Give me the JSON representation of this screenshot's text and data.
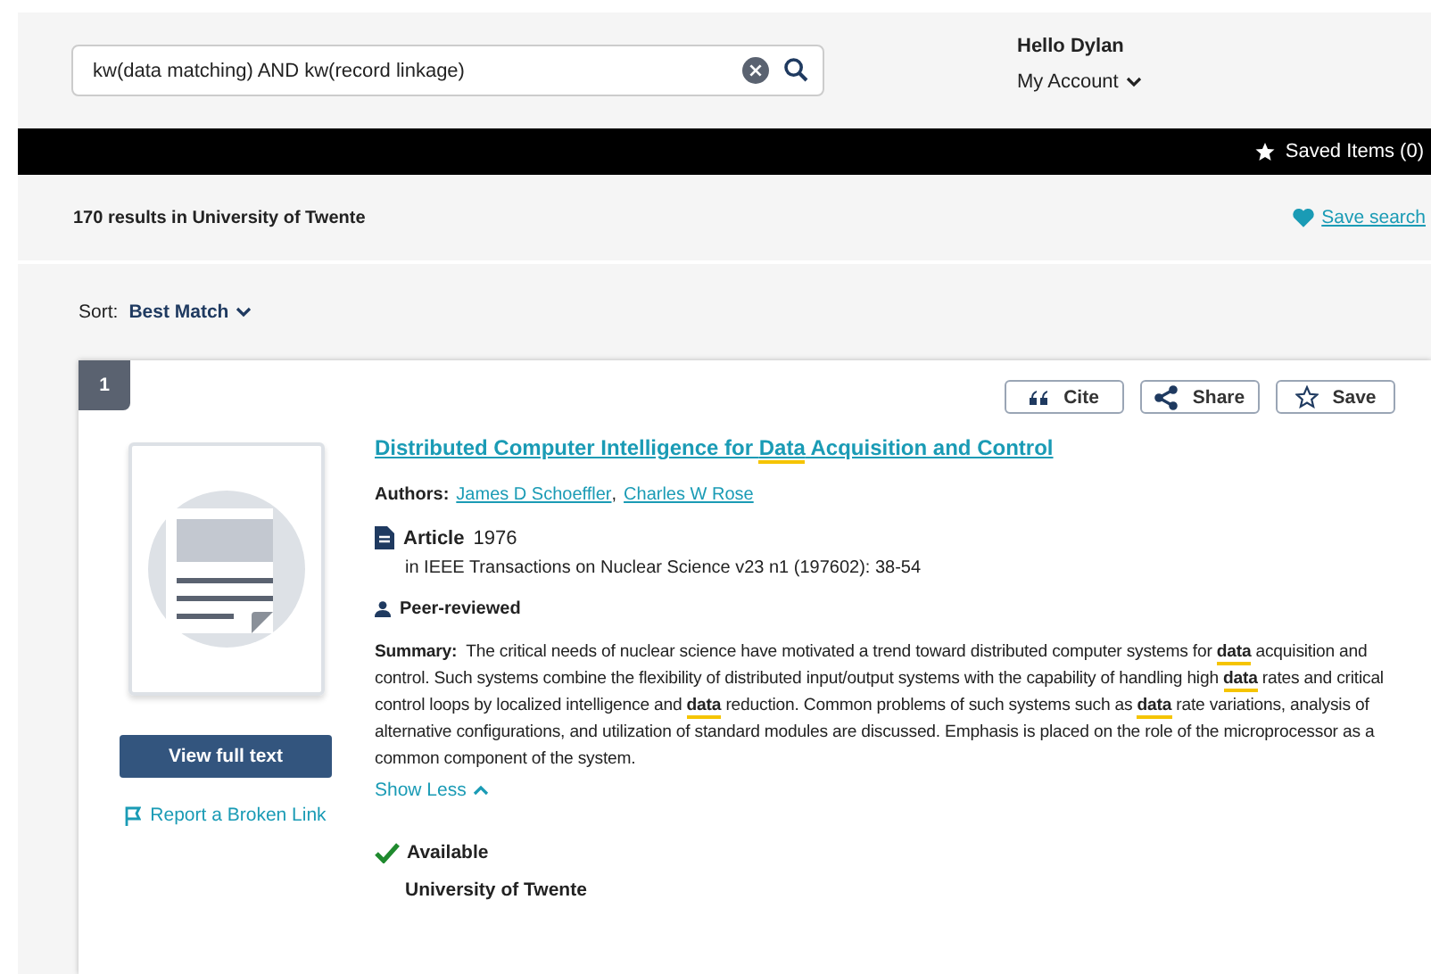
{
  "search": {
    "value": "kw(data matching) AND kw(record linkage)"
  },
  "account": {
    "greeting": "Hello Dylan",
    "menu": "My Account"
  },
  "saved_items": "Saved Items (0)",
  "results": {
    "count": "170 results in University of Twente",
    "save_search": "Save search"
  },
  "sort": {
    "label": "Sort:",
    "value": "Best Match"
  },
  "result": {
    "number": "1",
    "actions": [
      {
        "kind": "cite",
        "label": "Cite"
      },
      {
        "kind": "share",
        "label": "Share"
      },
      {
        "kind": "save",
        "label": "Save"
      }
    ],
    "title": "Distributed Computer Intelligence for *Data* Acquisition and Control",
    "authors_label": "Authors:",
    "authors": [
      {
        "name": "James D Schoeffler",
        "separator": ","
      },
      {
        "name": "Charles W Rose"
      }
    ],
    "type": "Article",
    "year": "1976",
    "source": "in IEEE Transactions on Nuclear Science v23 n1 (197602): 38-54",
    "peer_reviewed": "Peer-reviewed",
    "summary_label": "Summary:",
    "summary": "The critical needs of nuclear science have motivated a trend toward distributed computer systems for **data** acquisition and control. Such systems combine the flexibility of distributed input/output systems with the capability of handling high **data** rates and critical control loops by localized intelligence and **data** reduction. Common problems of such systems such as **data** rate variations, analysis of alternative configurations, and utilization of standard modules are discussed. Emphasis is placed on the role of the microprocessor as a common component of the system.",
    "show_less": "Show Less",
    "view_button": "View full text",
    "report_link": "Report a Broken Link",
    "availability": "Available",
    "library": "University of Twente"
  }
}
